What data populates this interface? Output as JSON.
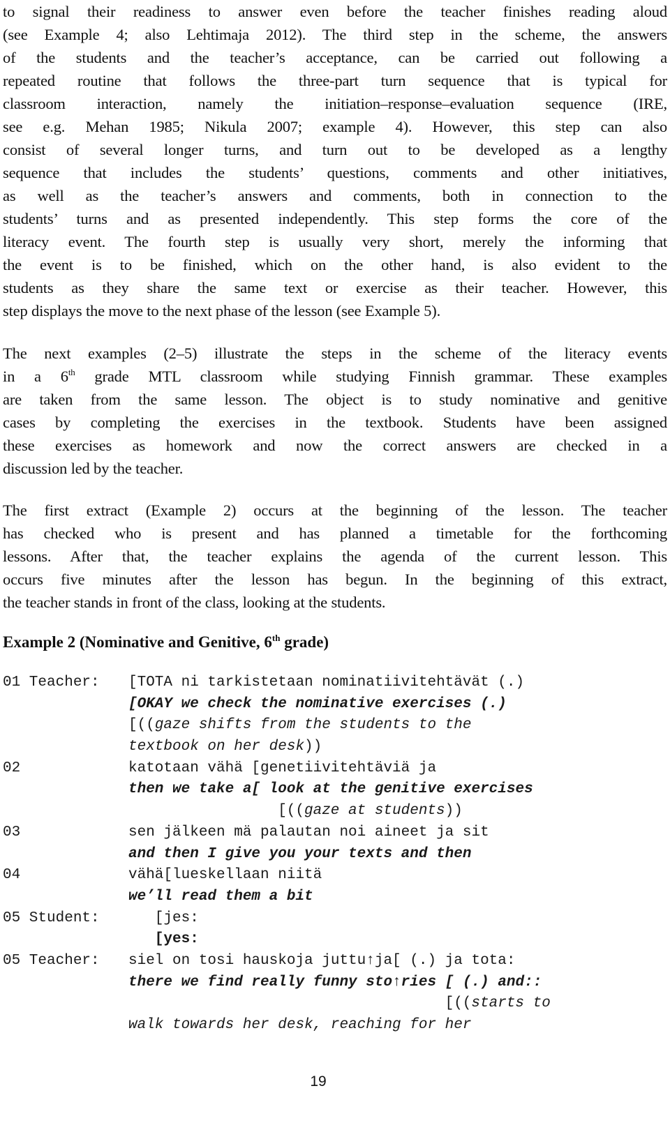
{
  "paragraphs": [
    {
      "lines": [
        "to signal their readiness to answer even before the teacher finishes reading aloud",
        "(see Example 4; also Lehtimaja 2012). The third step in the scheme, the answers",
        "of the students and the teacher’s acceptance, can be carried out following a",
        "repeated routine that follows the three-part turn sequence that is typical for",
        "classroom interaction, namely the initiation–response–evaluation sequence (IRE,",
        "see e.g. Mehan 1985; Nikula 2007; example 4). However, this step can also",
        "consist of several longer turns, and turn out to be developed as a lengthy",
        "sequence that includes the students’ questions, comments and other initiatives,",
        "as well as the teacher’s answers and comments, both in connection to the",
        "students’ turns and as presented independently. This step forms the core of the",
        "literacy event. The fourth step is usually very short, merely the informing that",
        "the event is to be finished, which on the other hand, is also evident to the",
        "students as they share the same text or exercise as their teacher. However, this",
        "step displays the move to the next phase of the lesson (see Example 5)."
      ]
    },
    {
      "line1_pre": "The next examples (2–5) illustrate the steps in the scheme of the literacy events",
      "line2_a": "in a 6",
      "line2_sup": "th",
      "line2_b": " grade MTL classroom while studying Finnish grammar. These examples",
      "lines_rest": [
        "are taken from the same lesson. The object is to study nominative and genitive",
        "cases by completing the exercises in the textbook. Students have been assigned",
        "these exercises as homework and now the correct answers are checked in a",
        "discussion led by the teacher."
      ]
    },
    {
      "lines": [
        "The first extract (Example 2) occurs at the beginning of the lesson. The teacher",
        "has checked who is present and has planned a timetable for the forthcoming",
        "lessons. After that, the teacher explains the agenda of the current lesson. This",
        "occurs five minutes after the lesson has begun. In the beginning of this extract,",
        "the teacher stands in front of the class, looking at the students."
      ]
    }
  ],
  "example_heading": {
    "pre": "Example 2 (Nominative and Genitive, 6",
    "sup": "th",
    "post": " grade)"
  },
  "transcript": [
    {
      "label": "01 Teacher:",
      "text": "[TOTA ni tarkistetaan nominatiivitehtävät (.)",
      "style": "plain",
      "indent": 0
    },
    {
      "label": "",
      "text": "[OKAY we check the nominative exercises (.)",
      "style": "gloss",
      "indent": 0
    },
    {
      "label": "",
      "text_pre": "[((",
      "text": "gaze shifts from the students to the",
      "style": "action",
      "indent": 0
    },
    {
      "label": "",
      "text": "textbook on her desk",
      "text_post": "))",
      "style": "action",
      "indent": 0
    },
    {
      "label": "02",
      "text": "katotaan vähä [genetiivitehtäviä ja",
      "style": "plain",
      "indent": 0
    },
    {
      "label": "",
      "text": "then we take a[ look at the genitive exercises",
      "style": "gloss",
      "indent": 0
    },
    {
      "label": "",
      "text_pre": "[((",
      "text": "gaze at students",
      "text_post": "))",
      "style": "action",
      "indent": 17
    },
    {
      "label": "03",
      "text": "sen jälkeen mä palautan noi aineet ja sit",
      "style": "plain",
      "indent": 0
    },
    {
      "label": "",
      "text": "and then I give you your texts and then",
      "style": "gloss",
      "indent": 0
    },
    {
      "label": "04",
      "text": "vähä[lueskellaan niitä",
      "style": "plain",
      "indent": 0
    },
    {
      "label": "",
      "text": "we’ll read them a bit",
      "style": "gloss",
      "indent": 0
    },
    {
      "label": "05 Student:",
      "text": "[jes:",
      "style": "plain",
      "indent": 3
    },
    {
      "label": "",
      "text": "[yes:",
      "style": "plainbold",
      "indent": 3
    },
    {
      "label": "05 Teacher:",
      "text": "siel on tosi hauskoja juttu↑ja[ (.) ja tota:",
      "style": "plain",
      "indent": 0
    },
    {
      "label": "",
      "text": "there we find really funny sto↑ries [ (.) and::",
      "style": "gloss",
      "indent": 0
    },
    {
      "label": "",
      "text_pre": "[((",
      "text": "starts to",
      "style": "action",
      "indent": 36
    },
    {
      "label": "",
      "text": "walk towards her desk, reaching for her",
      "style": "action",
      "indent": 0
    }
  ],
  "page_number": "19"
}
